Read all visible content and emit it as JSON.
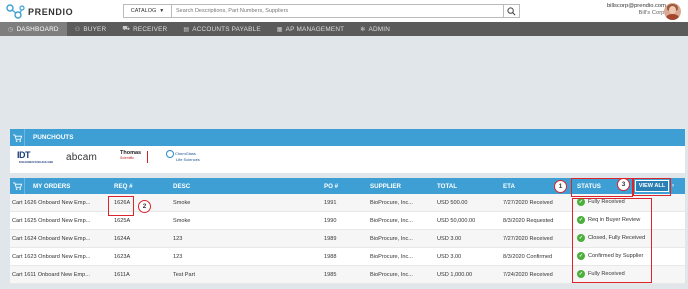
{
  "header": {
    "logo_text": "PRENDIO",
    "catalog_label": "CATALOG",
    "search_placeholder": "Search Descriptions, Part Numbers, Suppliers",
    "user_email": "billscorp@prendio.com",
    "user_company": "Bill's Corp."
  },
  "nav": {
    "items": [
      {
        "label": "DASHBOARD",
        "icon": "dashboard-icon"
      },
      {
        "label": "BUYER",
        "icon": "buyer-icon"
      },
      {
        "label": "RECEIVER",
        "icon": "receiver-icon"
      },
      {
        "label": "ACCOUNTS PAYABLE",
        "icon": "accounts-payable-icon"
      },
      {
        "label": "AP MANAGEMENT",
        "icon": "ap-management-icon"
      },
      {
        "label": "ADMIN",
        "icon": "gear-icon"
      }
    ]
  },
  "punchouts": {
    "title": "PUNCHOUTS",
    "logos": {
      "idt": "IDT",
      "idt_sub": "INTEGRATED DNA TECHNOLOGIES",
      "abcam": "abcam",
      "thomas": "Thomas",
      "thomas_sub": "Scientific",
      "chem": "ChemGlass",
      "chem_sub": "Life Sciences"
    }
  },
  "orders": {
    "title": "MY ORDERS",
    "columns": {
      "req": "REQ #",
      "desc": "DESC",
      "po": "PO #",
      "supplier": "SUPPLIER",
      "total": "TOTAL",
      "eta": "ETA",
      "status": "STATUS"
    },
    "view_all": "VIEW ALL",
    "rows": [
      {
        "name": "Cart 1626 Onboard New Emp...",
        "req": "1626A",
        "desc": "Smoke",
        "po": "1991",
        "supplier": "BioProcure, Inc...",
        "total": "USD 500.00",
        "eta": "7/27/2020 Received",
        "status": "Fully Received"
      },
      {
        "name": "Cart 1625 Onboard New Emp...",
        "req": "1625A",
        "desc": "Smoke",
        "po": "1990",
        "supplier": "BioProcure, Inc...",
        "total": "USD 50,000.00",
        "eta": "8/3/2020 Requested",
        "status": "Req in Buyer Review"
      },
      {
        "name": "Cart 1624 Onboard New Emp...",
        "req": "1624A",
        "desc": "123",
        "po": "1989",
        "supplier": "BioProcure, Inc...",
        "total": "USD 3.00",
        "eta": "7/27/2020 Received",
        "status": "Closed, Fully Received"
      },
      {
        "name": "Cart 1623 Onboard New Emp...",
        "req": "1623A",
        "desc": "123",
        "po": "1988",
        "supplier": "BioProcure, Inc...",
        "total": "USD 3.00",
        "eta": "8/3/2020 Confirmed",
        "status": "Confirmed by Supplier"
      },
      {
        "name": "Cart 1611 Onboard New Emp...",
        "req": "1611A",
        "desc": "Test Part",
        "po": "1985",
        "supplier": "BioProcure, Inc...",
        "total": "USD 1,000.00",
        "eta": "7/24/2020 Received",
        "status": "Fully Received"
      }
    ]
  },
  "annotations": {
    "one": "1",
    "two": "2",
    "three": "3",
    "color": "#d9252b"
  }
}
